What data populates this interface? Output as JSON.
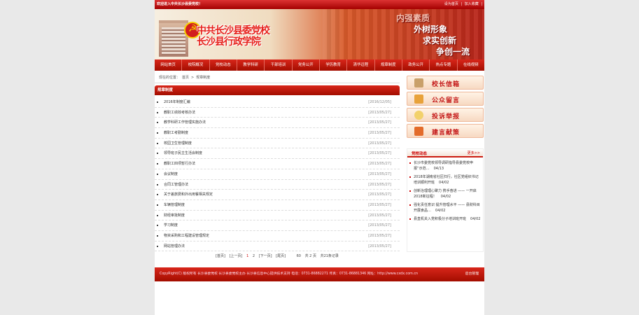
{
  "topbar": {
    "welcome": "欢迎进入中共长沙县委党校！",
    "links": [
      "设为首页",
      "|",
      "加入收藏",
      "|"
    ]
  },
  "banner": {
    "title_line1": "中共长沙县委党校",
    "title_line2": "长沙县行政学院",
    "slogan1": "内强素质",
    "slogan2": "外树形象",
    "slogan3": "求实创新",
    "slogan4": "争创一流"
  },
  "nav": [
    "网站首页",
    "校院概况",
    "党校动态",
    "教学科研",
    "干部培训",
    "党务公开",
    "学历教育",
    "清华远程",
    "规章制度",
    "政务公开",
    "热点专题",
    "在线视频"
  ],
  "breadcrumb": {
    "label": "现在的位置：",
    "home": "首页",
    "sep": ">",
    "current": "规章制度"
  },
  "list": {
    "header": "规章制度",
    "rows": [
      {
        "title": "2016年制度汇编",
        "date": "[2016/12/05]"
      },
      {
        "title": "教职工绩效考核办法",
        "date": "[2013/05/27]"
      },
      {
        "title": "教学科研工作管理实施办法",
        "date": "[2013/05/27]"
      },
      {
        "title": "教职工考勤制度",
        "date": "[2013/05/27]"
      },
      {
        "title": "校园卫生管理制度",
        "date": "[2013/05/27]"
      },
      {
        "title": "领导班子民主生活会制度",
        "date": "[2013/05/27]"
      },
      {
        "title": "教职工四项暂行办法",
        "date": "[2013/05/27]"
      },
      {
        "title": "会议制度",
        "date": "[2013/05/27]"
      },
      {
        "title": "合同工管理办法",
        "date": "[2013/05/27]"
      },
      {
        "title": "关于差旅费和外出用餐相关规定",
        "date": "[2013/05/27]"
      },
      {
        "title": "车辆管理制度",
        "date": "[2013/05/27]"
      },
      {
        "title": "财经审批制度",
        "date": "[2013/05/27]"
      },
      {
        "title": "学习制度",
        "date": "[2013/05/27]"
      },
      {
        "title": "物资采购和工程建设管理规定",
        "date": "[2013/05/27]"
      },
      {
        "title": "网站管理办法",
        "date": "[2013/05/27]"
      }
    ]
  },
  "pager": {
    "first": "[首页]",
    "prev": "[上一页]",
    "p1": "1",
    "p2": "2",
    "next": "[下一页]",
    "last": "[尾页]",
    "perpage": "60",
    "total_pages": "共 2 页",
    "total_records": "共21条记录"
  },
  "side_buttons": [
    {
      "label": "校长信箱",
      "icon": "mailbox-icon",
      "color": "#c9a06a"
    },
    {
      "label": "公众留言",
      "icon": "message-icon",
      "color": "#e8a23a"
    },
    {
      "label": "投诉举报",
      "icon": "lightbulb-icon",
      "color": "#f2d16b"
    },
    {
      "label": "建言献策",
      "icon": "folder-icon",
      "color": "#e36b2a"
    }
  ],
  "side_news": {
    "title": "党校动态",
    "more": "更多>>",
    "items": [
      {
        "text": "长沙市委党校领导调研指导县委党校申报“示范…",
        "date": "04/13"
      },
      {
        "text": "2018年湖南省社区扫行，社区党组织书记培训顺利开班",
        "date": "04/02"
      },
      {
        "text": "创新治理理心聚力 携手奋进 —— 一开启2018新征程！",
        "date": "04/02"
      },
      {
        "text": "强化责任意识 提升管理水平 —— 县财科目开展食品…",
        "date": "04/02"
      },
      {
        "text": "县直机关入党积极分子培训班开班",
        "date": "04/02"
      }
    ]
  },
  "footer": {
    "text": "CopyRight(C) 版权所有 长沙县委党校 长沙县委党校主办 长沙县信息中心提供技术支持 电话：0731-86882271 传真：0731-86881346 网址：http://www.cxdx.com.cn",
    "admin": "后台管理"
  }
}
